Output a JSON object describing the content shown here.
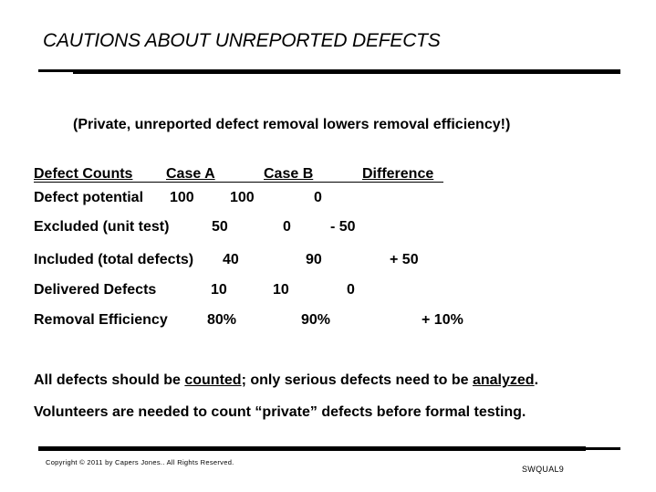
{
  "slide": {
    "title": "CAUTIONS ABOUT UNREPORTED DEFECTS",
    "subtitle": "(Private, unreported defect removal lowers removal efficiency!)",
    "table": {
      "headers": [
        "Defect Counts",
        "Case A",
        "Case B",
        "Difference"
      ],
      "rows": [
        {
          "label": "Defect potential",
          "case_a": "100",
          "case_b": "100",
          "difference": "0"
        },
        {
          "label": "Excluded (unit test)",
          "case_a": "50",
          "case_b": "0",
          "difference": "- 50"
        },
        {
          "label": "Included (total defects)",
          "case_a": "40",
          "case_b": "90",
          "difference": "+ 50"
        },
        {
          "label": "Delivered Defects",
          "case_a": "10",
          "case_b": "10",
          "difference": "0"
        },
        {
          "label": "Removal Efficiency",
          "case_a": "80%",
          "case_b": "90%",
          "difference": "+ 10%"
        }
      ]
    },
    "statement1": {
      "part1": "All defects should be ",
      "counted": "counted",
      "part2": "; only serious defects need to be ",
      "analyzed": "analyzed",
      "part3": "."
    },
    "statement2": "Volunteers are needed to count “private” defects before formal testing.",
    "footer": {
      "copyright": "Copyright © 2011 by Capers Jones.. All Rights Reserved.",
      "slide_id": "SWQUAL9"
    }
  }
}
